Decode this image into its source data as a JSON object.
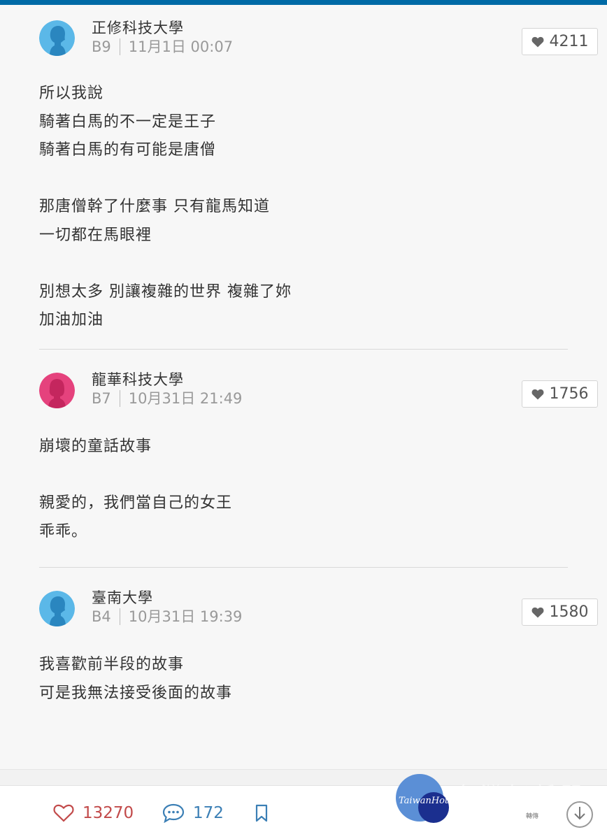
{
  "comments": [
    {
      "school": "正修科技大學",
      "floor": "B9",
      "time": "11月1日 00:07",
      "likes": "4211",
      "avatar": "male-avatar",
      "avatar_color": "#5bb8e8",
      "lines": [
        "所以我說",
        "騎著白馬的不一定是王子",
        "騎著白馬的有可能是唐僧",
        "",
        "那唐僧幹了什麼事 只有龍馬知道",
        "一切都在馬眼裡",
        "",
        "別想太多 別讓複雜的世界 複雜了妳",
        "加油加油"
      ]
    },
    {
      "school": "龍華科技大學",
      "floor": "B7",
      "time": "10月31日 21:49",
      "likes": "1756",
      "avatar": "female-avatar",
      "avatar_color": "#e5427d",
      "lines": [
        "崩壞的童話故事",
        "",
        "親愛的，我們當自己的女王",
        "乖乖。"
      ]
    },
    {
      "school": "臺南大學",
      "floor": "B4",
      "time": "10月31日 19:39",
      "likes": "1580",
      "avatar": "male-avatar",
      "avatar_color": "#5bb8e8",
      "lines": [
        "我喜歡前半段的故事",
        "可是我無法接受後面的故事"
      ]
    }
  ],
  "footer": {
    "total_likes": "13270",
    "total_comments": "172",
    "logo_text": "TaiwanHot",
    "watermark": "台灣好新聞",
    "small_label": "轉傳"
  },
  "colors": {
    "top_bar": "#006aa6",
    "like_red": "#c24a4a",
    "comment_blue": "#3b7fb5"
  }
}
